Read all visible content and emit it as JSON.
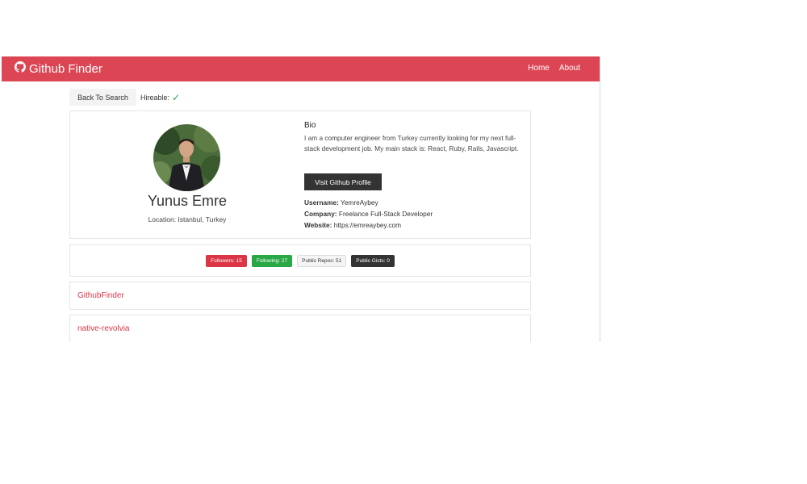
{
  "navbar": {
    "brand": "Github Finder",
    "links": [
      "Home",
      "About"
    ]
  },
  "toolbar": {
    "back_label": "Back To Search",
    "hireable_label": "Hireable:",
    "hireable_icon": "check-icon"
  },
  "profile": {
    "name": "Yunus Emre",
    "location": "Location: Istanbul, Turkey",
    "bio_heading": "Bio",
    "bio": "I am a computer engineer from Turkey currently looking for my next full-stack development job. My main stack is: React, Ruby, Rails, Javascript.",
    "visit_label": "Visit Github Profile",
    "username_label": "Username:",
    "username": "YemreAybey",
    "company_label": "Company:",
    "company": "Freelance Full-Stack Developer",
    "website_label": "Website:",
    "website": "https://emreaybey.com"
  },
  "stats": {
    "followers": "Followers: 15",
    "following": "Following: 27",
    "public_repos": "Public Repos: 51",
    "public_gists": "Public Gists: 0"
  },
  "repos": [
    {
      "name": "GithubFinder"
    },
    {
      "name": "native-revolvia"
    }
  ],
  "colors": {
    "primary": "#dc4654",
    "success": "#28a745",
    "dark": "#333333"
  }
}
